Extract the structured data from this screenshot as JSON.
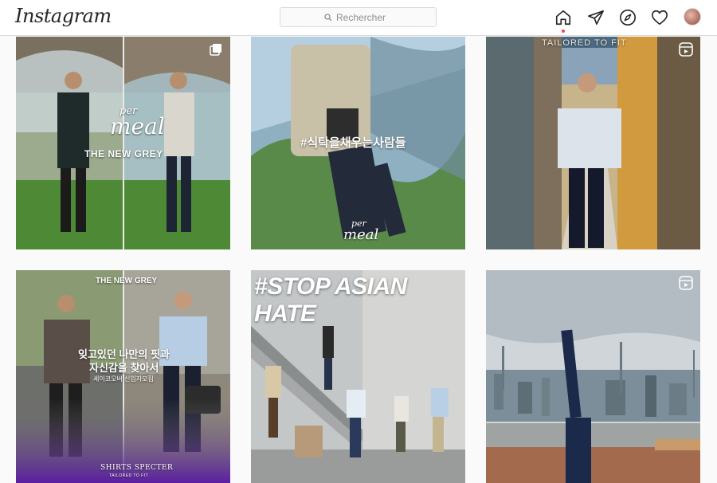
{
  "app": {
    "logo": "Instagram"
  },
  "search": {
    "placeholder": "Rechercher"
  },
  "nav": {
    "icons": [
      "home-icon",
      "direct-icon",
      "explore-icon",
      "heart-icon",
      "avatar"
    ]
  },
  "posts": [
    {
      "type": "carousel",
      "overlay": {
        "brand_top": "per",
        "brand_main": "meal",
        "caption": "THE NEW GREY"
      }
    },
    {
      "type": "image",
      "overlay": {
        "hashtag": "#식탁을채우는사람들",
        "brand_top": "per",
        "brand_main": "meal"
      }
    },
    {
      "type": "reel",
      "overlay": {
        "banner": "TAILORED TO FIT"
      }
    },
    {
      "type": "image",
      "overlay": {
        "caption": "THE NEW GREY",
        "line1": "잊고있던 나만의 핏과",
        "line2": "자신감을 찾아서",
        "line3": "셰이코오버 신입자모집",
        "brand": "SHIRTS SPECTER",
        "brand_sub": "TAILORED TO FIT"
      }
    },
    {
      "type": "image",
      "overlay": {
        "headline": "#STOP ASIAN HATE"
      }
    },
    {
      "type": "reel",
      "overlay": {}
    }
  ],
  "colors": {
    "accent_dot": "#ed4956",
    "border": "#dbdbdb",
    "text": "#262626"
  }
}
